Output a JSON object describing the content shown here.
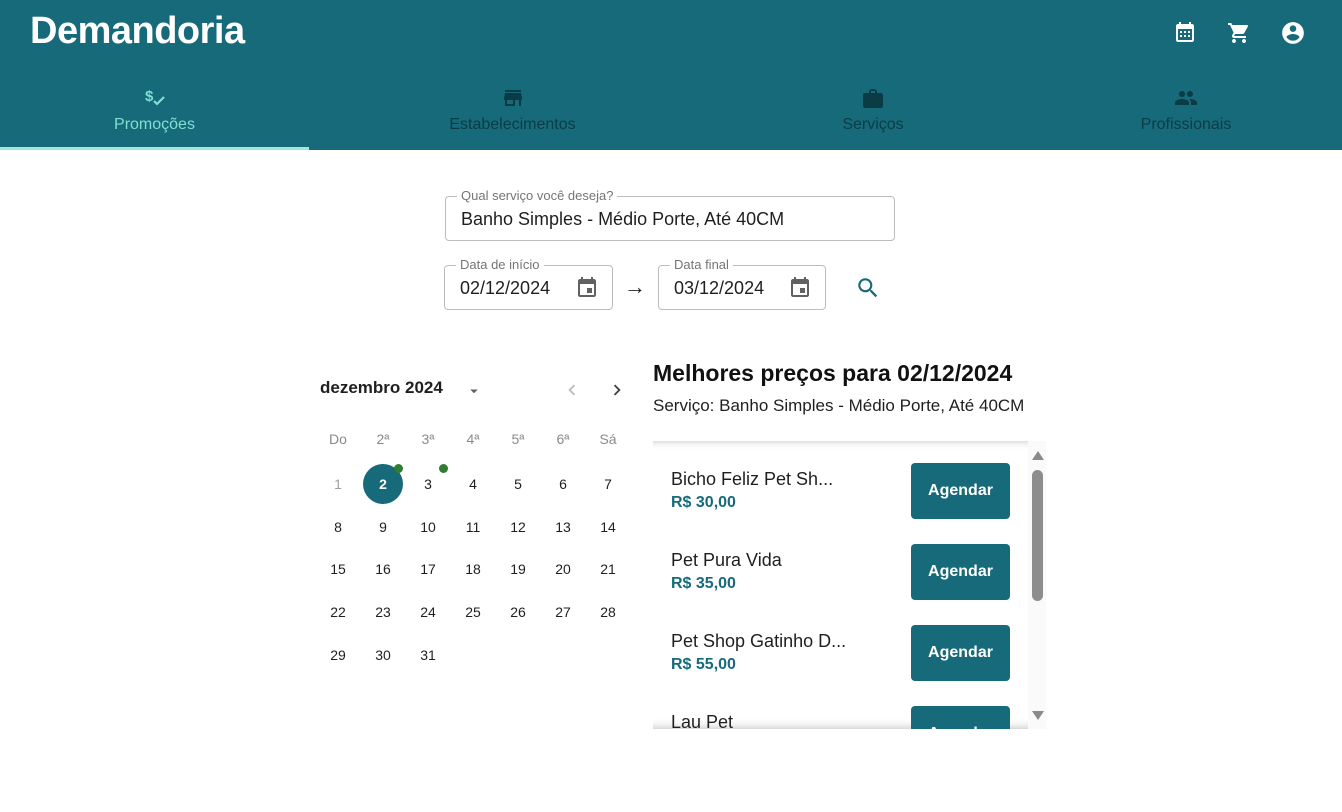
{
  "app": {
    "title": "Demandoria",
    "icons": [
      "calendar-icon",
      "cart-icon",
      "account-icon"
    ]
  },
  "tabs": [
    {
      "label": "Promoções",
      "icon": "discount-icon",
      "active": true
    },
    {
      "label": "Estabelecimentos",
      "icon": "store-icon",
      "active": false
    },
    {
      "label": "Serviços",
      "icon": "briefcase-icon",
      "active": false
    },
    {
      "label": "Profissionais",
      "icon": "people-icon",
      "active": false
    }
  ],
  "search": {
    "service_label": "Qual serviço você deseja?",
    "service_value": "Banho Simples - Médio Porte, Até 40CM",
    "start_label": "Data de início",
    "start_value": "02/12/2024",
    "end_label": "Data final",
    "end_value": "03/12/2024",
    "separator": "→"
  },
  "calendar": {
    "month_label": "dezembro 2024",
    "weekdays": [
      "Do",
      "2ª",
      "3ª",
      "4ª",
      "5ª",
      "6ª",
      "Sá"
    ],
    "weeks": [
      [
        "1",
        "2",
        "3",
        "4",
        "5",
        "6",
        "7"
      ],
      [
        "8",
        "9",
        "10",
        "11",
        "12",
        "13",
        "14"
      ],
      [
        "15",
        "16",
        "17",
        "18",
        "19",
        "20",
        "21"
      ],
      [
        "22",
        "23",
        "24",
        "25",
        "26",
        "27",
        "28"
      ],
      [
        "29",
        "30",
        "31"
      ]
    ],
    "selected_day": "2",
    "disabled_days": [
      "1"
    ],
    "marked_days": [
      "2",
      "3"
    ]
  },
  "results": {
    "title": "Melhores preços para 02/12/2024",
    "subtitle": "Serviço: Banho Simples - Médio Porte, Até 40CM",
    "button_label": "Agendar",
    "items": [
      {
        "name": "Bicho Feliz Pet Sh...",
        "price": "R$ 30,00"
      },
      {
        "name": "Pet Pura Vida",
        "price": "R$ 35,00"
      },
      {
        "name": "Pet Shop Gatinho D...",
        "price": "R$ 55,00"
      },
      {
        "name": "Lau Pet",
        "price": ""
      }
    ]
  },
  "colors": {
    "primary": "#176a7a",
    "active_tab": "#7fe0d2",
    "marker": "#2e7d32"
  }
}
